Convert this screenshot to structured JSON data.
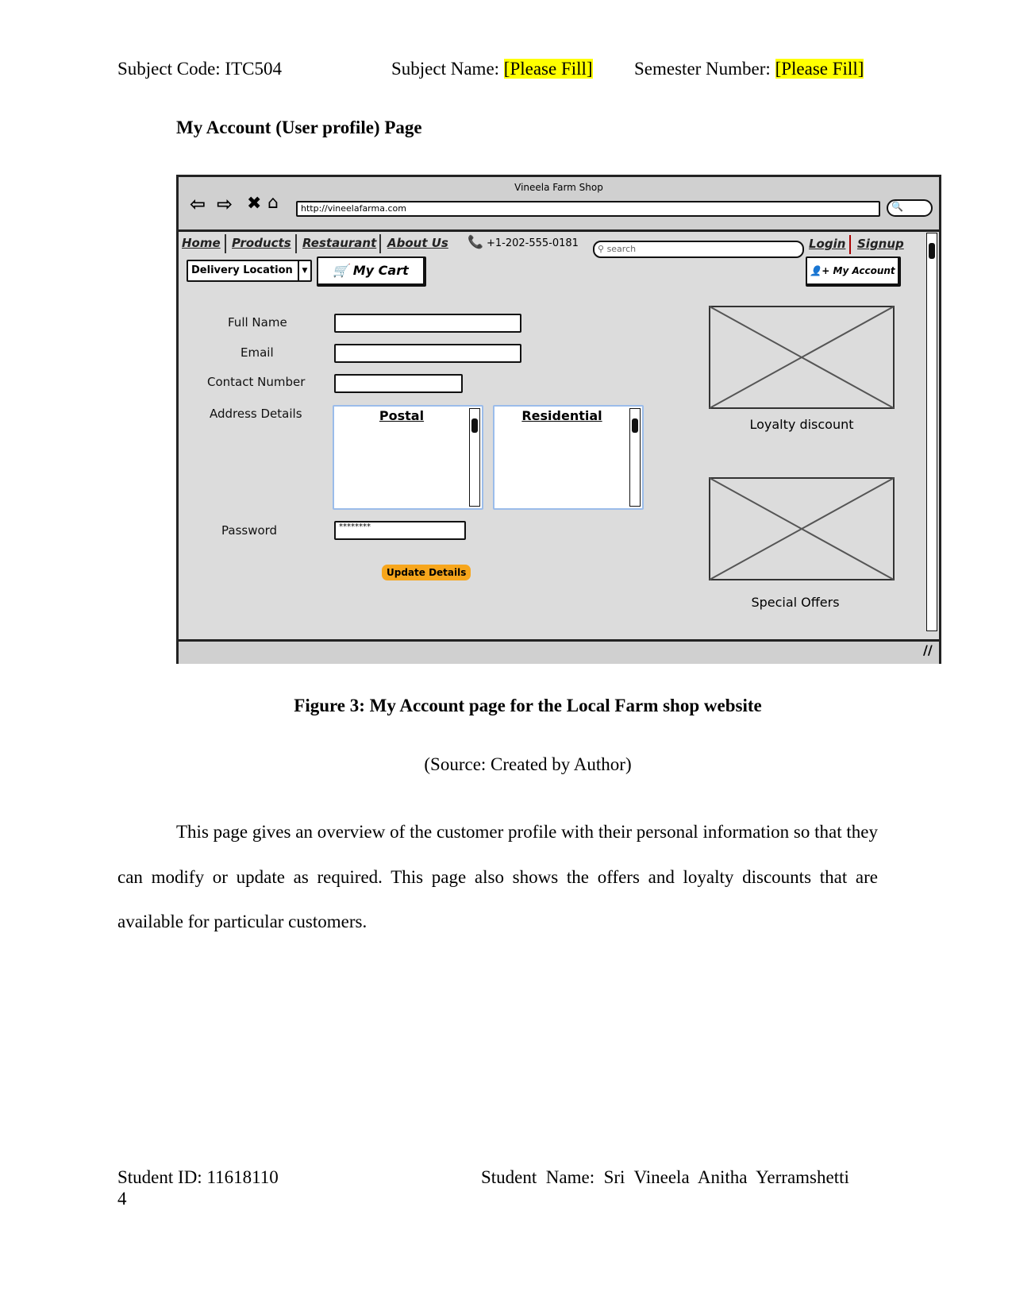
{
  "header": {
    "subject_code": "Subject Code: ITC504",
    "subject_name_label": "Subject Name: ",
    "subject_name_value": "[Please Fill]",
    "semester_label": "Semester Number: ",
    "semester_value": "[Please Fill]"
  },
  "section_title": "My Account (User profile) Page",
  "mockup": {
    "window_title": "Vineela Farm Shop",
    "url": "http://vineelafarma.com",
    "nav": [
      "Home",
      "Products",
      "Restaurant",
      "About Us"
    ],
    "phone": "+1-202-555-0181",
    "search_placeholder": "search",
    "login": "Login",
    "signup": "Signup",
    "delivery_location": "Delivery Location",
    "my_cart": "My Cart",
    "my_account": "My Account",
    "form": {
      "full_name": "Full Name",
      "email": "Email",
      "contact": "Contact Number",
      "address": "Address Details",
      "postal": "Postal",
      "residential": "Residential",
      "password": "Password",
      "password_value": "********",
      "update": "Update Details"
    },
    "loyalty": "Loyalty discount",
    "offers": "Special Offers",
    "accent": "#f7a61c"
  },
  "caption": "Figure 3: My Account page for the Local Farm shop website",
  "source": "(Source: Created by Author)",
  "paragraph": "This page gives an overview of the customer profile with their personal information so that they can modify or update as required. This page also shows the offers and loyalty discounts that are available for particular customers.",
  "footer": {
    "student_id": "Student  ID:  11618110",
    "student_name": "Student  Name:  Sri  Vineela  Anitha  Yerramshetti",
    "page_number": "4"
  }
}
